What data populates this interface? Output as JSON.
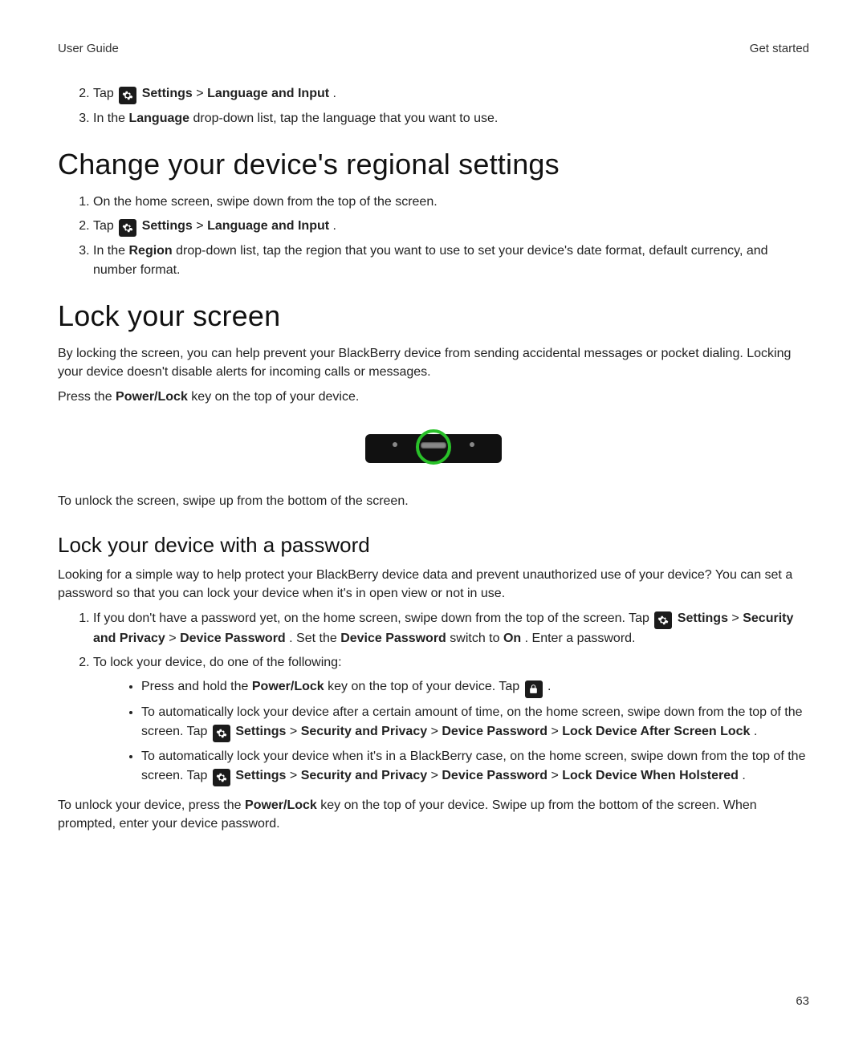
{
  "header": {
    "left": "User Guide",
    "right": "Get started"
  },
  "steps_top": {
    "s2": {
      "pre": "Tap ",
      "settings": "Settings",
      "sep": " > ",
      "target": "Language and Input",
      "post": "."
    },
    "s3": {
      "pre": "In the ",
      "bold": "Language",
      "post": " drop-down list, tap the language that you want to use."
    }
  },
  "regional": {
    "heading": "Change your device's regional settings",
    "s1": "On the home screen, swipe down from the top of the screen.",
    "s2": {
      "pre": "Tap ",
      "settings": "Settings",
      "sep": " > ",
      "target": "Language and Input",
      "post": "."
    },
    "s3": {
      "pre": "In the ",
      "bold": "Region",
      "post": " drop-down list, tap the region that you want to use to set your device's date format, default currency, and number format."
    }
  },
  "lock": {
    "heading": "Lock your screen",
    "intro": "By locking the screen, you can help prevent your BlackBerry device from sending accidental messages or pocket dialing. Locking your device doesn't disable alerts for incoming calls or messages.",
    "press_pre": "Press the ",
    "press_bold": "Power/Lock",
    "press_post": " key on the top of your device.",
    "unlock": "To unlock the screen, swipe up from the bottom of the screen."
  },
  "password": {
    "heading": "Lock your device with a password",
    "intro": "Looking for a simple way to help protect your BlackBerry device data and prevent unauthorized use of your device? You can set a password so that you can lock your device when it's in open view or not in use.",
    "s1": {
      "pre": "If you don't have a password yet, on the home screen, swipe down from the top of the screen. Tap ",
      "settings": "Settings",
      "sep": " > ",
      "secpriv": "Security and Privacy",
      "devpass": "Device Password",
      "mid": ". Set the ",
      "devpass2": "Device Password",
      "switch_text": " switch to ",
      "on": "On",
      "post": ". Enter a password."
    },
    "s2_intro": "To lock your device, do one of the following:",
    "b1": {
      "pre": "Press and hold the ",
      "bold": "Power/Lock",
      "mid": " key on the top of your device. Tap ",
      "post": " ."
    },
    "b2": {
      "line1": "To automatically lock your device after a certain amount of time, on the home screen, swipe down from the top of the screen. Tap ",
      "settings": "Settings",
      "sep": " > ",
      "secpriv": "Security and Privacy",
      "devpass": "Device Password",
      "target": "Lock Device After Screen Lock",
      "post": "."
    },
    "b3": {
      "line1": "To automatically lock your device when it's in a BlackBerry case, on the home screen, swipe down from the top of the screen. Tap ",
      "settings": "Settings",
      "sep": " > ",
      "secpriv": "Security and Privacy",
      "devpass": "Device Password",
      "target": "Lock Device When Holstered",
      "post": "."
    },
    "unlock_pre": "To unlock your device, press the ",
    "unlock_bold": "Power/Lock",
    "unlock_post": " key on the top of your device. Swipe up from the bottom of the screen. When prompted, enter your device password."
  },
  "page_number": "63"
}
